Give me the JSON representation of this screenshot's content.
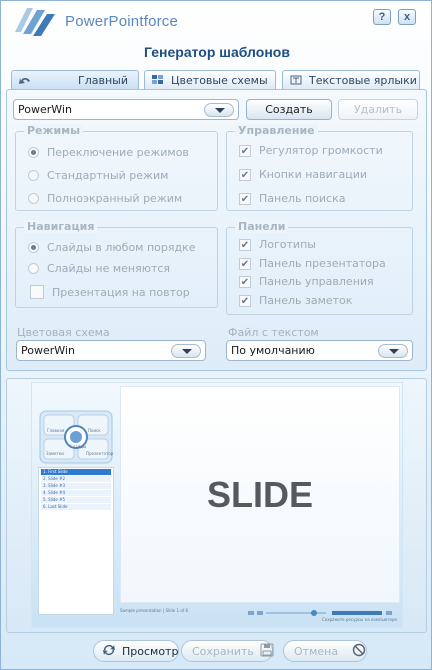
{
  "brand": {
    "name": "PowerPointforce"
  },
  "window_controls": {
    "help_label": "?",
    "close_label": "x"
  },
  "title": "Генератор шаблонов",
  "tabs": [
    {
      "label": "Главный",
      "icon": "main-icon",
      "active": true
    },
    {
      "label": "Цветовые схемы",
      "icon": "color-schemes-icon",
      "active": false
    },
    {
      "label": "Текстовые ярлыки",
      "icon": "text-labels-icon",
      "active": false
    }
  ],
  "template": {
    "selected": "PowerWin",
    "create_label": "Создать",
    "delete_label": "Удалить"
  },
  "modes": {
    "title": "Режимы",
    "options": [
      {
        "label": "Переключение режимов",
        "selected": true
      },
      {
        "label": "Стандартный режим",
        "selected": false
      },
      {
        "label": "Полноэкранный режим",
        "selected": false
      }
    ]
  },
  "controls": {
    "title": "Управление",
    "options": [
      {
        "label": "Регулятор громкости",
        "checked": true
      },
      {
        "label": "Кнопки навигации",
        "checked": true
      },
      {
        "label": "Панель поиска",
        "checked": true
      }
    ]
  },
  "navigation": {
    "title": "Навигация",
    "options": [
      {
        "label": "Слайды в любом порядке",
        "selected": true
      },
      {
        "label": "Слайды не меняются",
        "selected": false
      }
    ],
    "loop_label": "Презентация на повтор",
    "loop_checked": false
  },
  "panels": {
    "title": "Панели",
    "options": [
      {
        "label": "Логотипы",
        "checked": true
      },
      {
        "label": "Панель презентатора",
        "checked": true
      },
      {
        "label": "Панель управления",
        "checked": true
      },
      {
        "label": "Панель заметок",
        "checked": true
      }
    ]
  },
  "color_scheme": {
    "label": "Цветовая схема",
    "value": "PowerWin"
  },
  "text_file": {
    "label": "Файл с текстом",
    "value": "По умолчанию"
  },
  "preview": {
    "slide_text": "SLIDE",
    "circle_labels": [
      "Главная",
      "Поиск",
      "Заметки",
      "Слайды",
      "Презентатор"
    ],
    "slide_list": [
      "1. First Slide",
      "2. Slide #2",
      "3. Slide #3",
      "4. Slide #4",
      "5. Slide #5",
      "6. Last Slide"
    ],
    "footer_left": "Sample presentation | Slide 1 of 6",
    "footer_right": "Сохраните ресурсы на компьютере"
  },
  "footer": {
    "preview_label": "Просмотр",
    "save_label": "Сохранить",
    "cancel_label": "Отмена"
  },
  "colors": {
    "accent": "#1f4e84",
    "brand": "#5a88bd",
    "disabled_text": "#b6c0c9"
  }
}
